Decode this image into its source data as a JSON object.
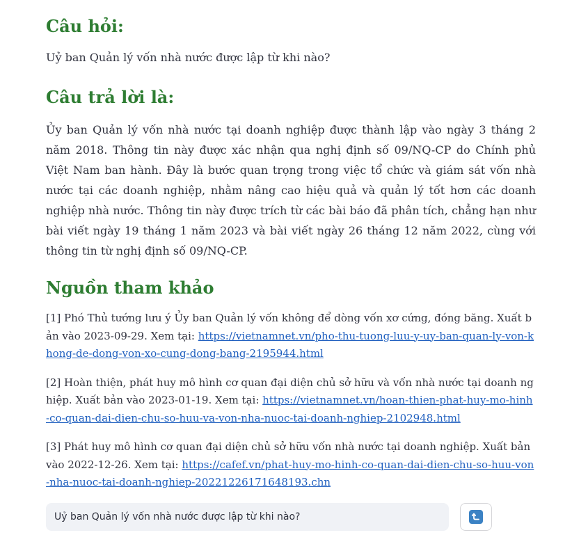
{
  "question": {
    "heading": "Câu hỏi:",
    "text": "Uỷ ban Quản lý vốn nhà nước được lập từ khi nào?"
  },
  "answer": {
    "heading": "Câu trả lời là:",
    "text": "Ủy ban Quản lý vốn nhà nước tại doanh nghiệp được thành lập vào ngày 3 tháng 2 năm 2018. Thông tin này được xác nhận qua nghị định số 09/NQ-CP do Chính phủ Việt Nam ban hành. Đây là bước quan trọng trong việc tổ chức và giám sát vốn nhà nước tại các doanh nghiệp, nhằm nâng cao hiệu quả và quản lý tốt hơn các doanh nghiệp nhà nước. Thông tin này được trích từ các bài báo đã phân tích, chẳng hạn như bài viết ngày 19 tháng 1 năm 2023 và bài viết ngày 26 tháng 12 năm 2022, cùng với thông tin từ nghị định số 09/NQ-CP."
  },
  "sources": {
    "heading": "Nguồn tham khảo",
    "items": [
      {
        "text": "[1] Phó Thủ tướng lưu ý Ủy ban Quản lý vốn không để dòng vốn xơ cứng, đóng băng. Xuất bản vào 2023-09-29. Xem tại: ",
        "url": "https://vietnamnet.vn/pho-thu-tuong-luu-y-uy-ban-quan-ly-von-khong-de-dong-von-xo-cung-dong-bang-2195944.html"
      },
      {
        "text": "[2] Hoàn thiện, phát huy mô hình cơ quan đại diện chủ sở hữu và vốn nhà nước tại doanh nghiệp. Xuất bản vào 2023-01-19. Xem tại: ",
        "url": "https://vietnamnet.vn/hoan-thien-phat-huy-mo-hinh-co-quan-dai-dien-chu-so-huu-va-von-nha-nuoc-tai-doanh-nghiep-2102948.html"
      },
      {
        "text": "[3] Phát huy mô hình cơ quan đại diện chủ sở hữu vốn nhà nước tại doanh nghiệp. Xuất bản vào 2022-12-26. Xem tại: ",
        "url": "https://cafef.vn/phat-huy-mo-hinh-co-quan-dai-dien-chu-so-huu-von-nha-nuoc-tai-doanh-nghiep-20221226171648193.chn"
      }
    ]
  },
  "chat_input": {
    "value": "Uỷ ban Quản lý vốn nhà nước được lập từ khi nào?",
    "send_icon": "return-arrow-icon"
  },
  "colors": {
    "heading": "#2e7d32",
    "link": "#1f5fbf",
    "input_bg": "#f0f2f6",
    "send_icon_bg": "#3b82c4"
  }
}
